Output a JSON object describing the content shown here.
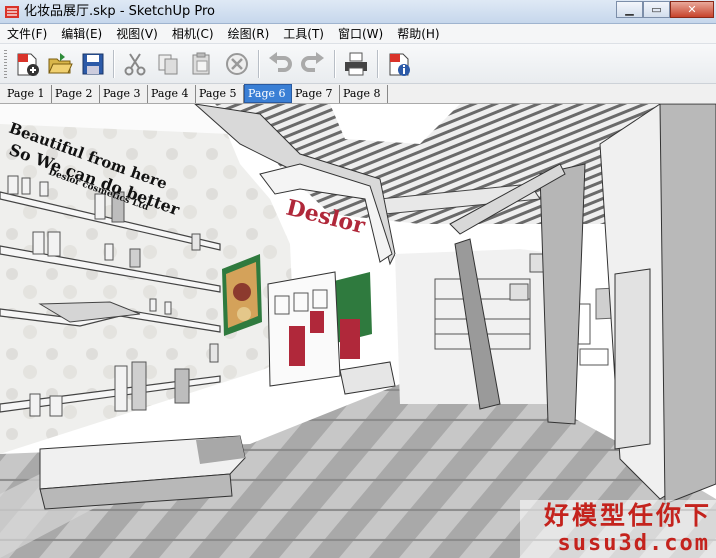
{
  "window": {
    "title": "化妆品展厅.skp - SketchUp Pro",
    "min": "▁",
    "max": "▭",
    "close": "✕"
  },
  "menu": [
    "文件(F)",
    "编辑(E)",
    "视图(V)",
    "相机(C)",
    "绘图(R)",
    "工具(T)",
    "窗口(W)",
    "帮助(H)"
  ],
  "toolbar": {
    "icons": [
      "new-model-icon",
      "open-folder-icon",
      "save-icon",
      "cut-icon",
      "copy-icon",
      "paste-icon",
      "erase-icon",
      "undo-icon",
      "redo-icon",
      "print-icon",
      "model-info-icon"
    ]
  },
  "tabs": [
    "Page 1",
    "Page 2",
    "Page 3",
    "Page 4",
    "Page 5",
    "Page 6",
    "Page 7",
    "Page 8"
  ],
  "active_tab": "Page 6",
  "scene": {
    "wall_text_1": "Beautiful from here",
    "wall_text_2": "So We can do better",
    "wall_text_3": "Deslor cosmetics Ltd",
    "sign_text": "Deslor"
  },
  "watermark": {
    "cn": "好模型任你下",
    "en": "susu3d.com"
  },
  "colors": {
    "accent": "#3a7fd5",
    "brand_red": "#c4231d",
    "sign_red": "#b0283a"
  }
}
